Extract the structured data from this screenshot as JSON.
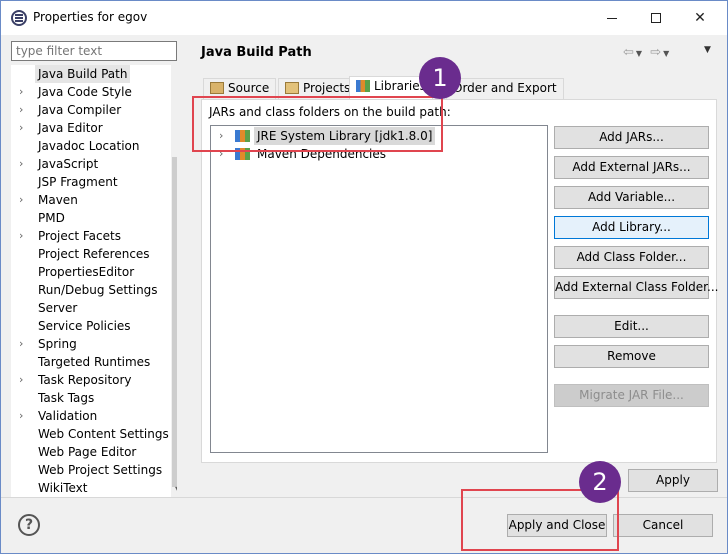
{
  "window": {
    "title": "Properties for egov"
  },
  "filter": {
    "placeholder": "type filter text"
  },
  "tree": [
    {
      "label": "Java Build Path",
      "expandable": false,
      "selected": true
    },
    {
      "label": "Java Code Style",
      "expandable": true
    },
    {
      "label": "Java Compiler",
      "expandable": true
    },
    {
      "label": "Java Editor",
      "expandable": true
    },
    {
      "label": "Javadoc Location",
      "expandable": false
    },
    {
      "label": "JavaScript",
      "expandable": true
    },
    {
      "label": "JSP Fragment",
      "expandable": false
    },
    {
      "label": "Maven",
      "expandable": true
    },
    {
      "label": "PMD",
      "expandable": false
    },
    {
      "label": "Project Facets",
      "expandable": true
    },
    {
      "label": "Project References",
      "expandable": false
    },
    {
      "label": "PropertiesEditor",
      "expandable": false
    },
    {
      "label": "Run/Debug Settings",
      "expandable": false
    },
    {
      "label": "Server",
      "expandable": false
    },
    {
      "label": "Service Policies",
      "expandable": false
    },
    {
      "label": "Spring",
      "expandable": true
    },
    {
      "label": "Targeted Runtimes",
      "expandable": false
    },
    {
      "label": "Task Repository",
      "expandable": true
    },
    {
      "label": "Task Tags",
      "expandable": false
    },
    {
      "label": "Validation",
      "expandable": true
    },
    {
      "label": "Web Content Settings",
      "expandable": false
    },
    {
      "label": "Web Page Editor",
      "expandable": false
    },
    {
      "label": "Web Project Settings",
      "expandable": false
    },
    {
      "label": "WikiText",
      "expandable": false
    }
  ],
  "page": {
    "title": "Java Build Path",
    "tabs": [
      {
        "label": "Source"
      },
      {
        "label": "Projects"
      },
      {
        "label": "Libraries",
        "active": true
      },
      {
        "label": "Order and Export"
      }
    ],
    "jars_label": "JARs and class folders on the build path:",
    "jars": [
      {
        "label": "JRE System Library [jdk1.8.0]",
        "selected": true
      },
      {
        "label": "Maven Dependencies"
      }
    ],
    "buttons": [
      {
        "label": "Add JARs..."
      },
      {
        "label": "Add External JARs..."
      },
      {
        "label": "Add Variable..."
      },
      {
        "label": "Add Library...",
        "focused": true
      },
      {
        "label": "Add Class Folder..."
      },
      {
        "label": "Add External Class Folder..."
      },
      {
        "label": "Edit..."
      },
      {
        "label": "Remove"
      },
      {
        "label": "Migrate JAR File...",
        "disabled": true
      }
    ],
    "apply_label": "Apply"
  },
  "footer": {
    "help_label": "?",
    "apply_close_label": "Apply and Close",
    "cancel_label": "Cancel"
  },
  "annotations": {
    "badge_1": "1",
    "badge_2": "2",
    "color": "#e0454f",
    "badge_color": "#6a2c8e"
  }
}
